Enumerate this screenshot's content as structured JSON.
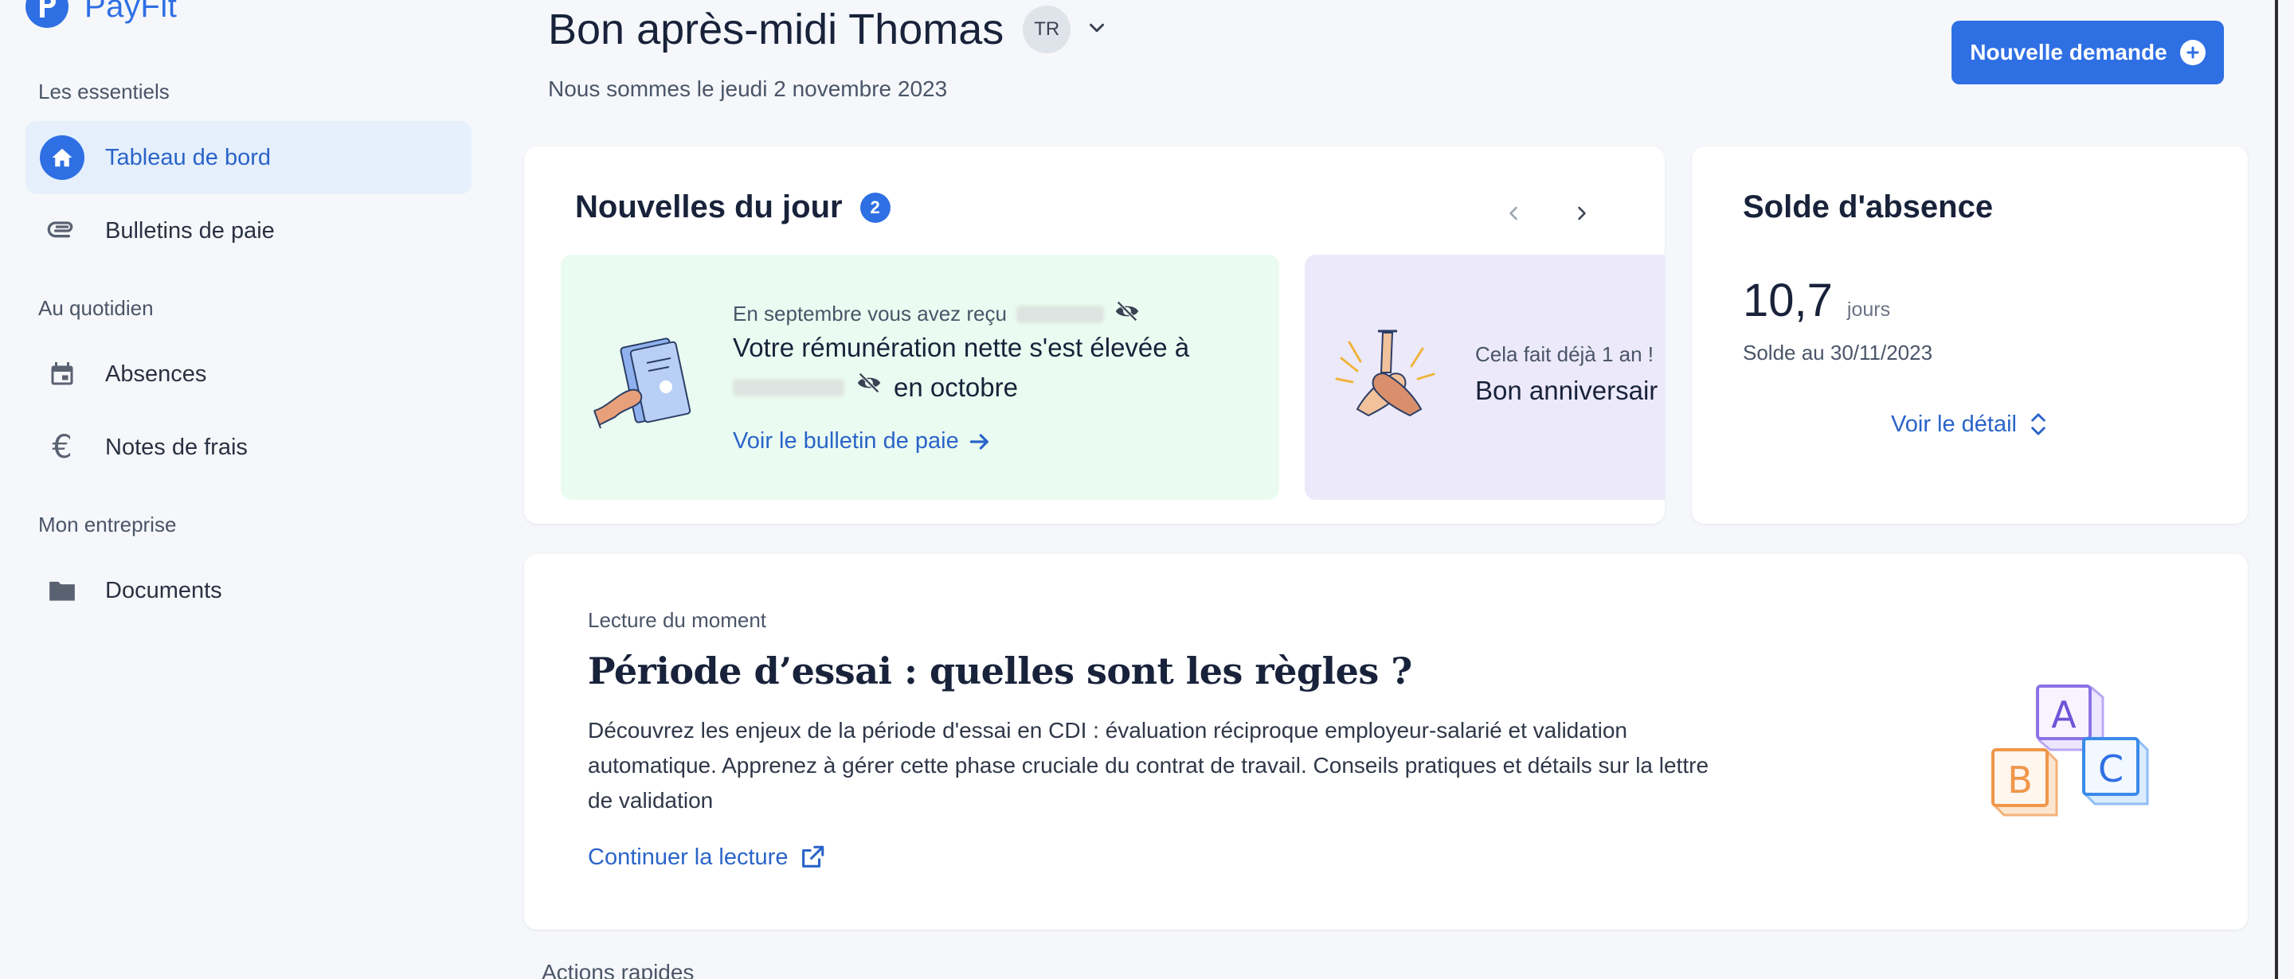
{
  "brand": {
    "name": "PayFit",
    "accent": "#2f6fe4"
  },
  "sidebar": {
    "sections": [
      {
        "label": "Les essentiels",
        "items": [
          {
            "label": "Tableau de bord",
            "icon": "home-icon",
            "active": true
          },
          {
            "label": "Bulletins de paie",
            "icon": "paperclip-icon",
            "active": false
          }
        ]
      },
      {
        "label": "Au quotidien",
        "items": [
          {
            "label": "Absences",
            "icon": "calendar-icon",
            "active": false
          },
          {
            "label": "Notes de frais",
            "icon": "euro-icon",
            "active": false
          }
        ]
      },
      {
        "label": "Mon entreprise",
        "items": [
          {
            "label": "Documents",
            "icon": "folder-icon",
            "active": false
          }
        ]
      }
    ]
  },
  "header": {
    "greeting": "Bon après-midi Thomas",
    "avatar_initials": "TR",
    "date": "Nous sommes le jeudi 2 novembre 2023",
    "new_request_label": "Nouvelle demande"
  },
  "news": {
    "title": "Nouvelles du jour",
    "count": "2",
    "items": [
      {
        "subtitle": "En septembre vous avez reçu",
        "main_line1": "Votre rémunération nette s'est élevée à",
        "main_line2_suffix": "en octobre",
        "link": "Voir le bulletin de paie"
      },
      {
        "subtitle": "Cela fait déjà 1 an !",
        "main": "Bon anniversair"
      }
    ]
  },
  "absence": {
    "title": "Solde d'absence",
    "value": "10,7",
    "unit": "jours",
    "balance_date": "Solde au 30/11/2023",
    "link": "Voir le détail"
  },
  "reading": {
    "kicker": "Lecture du moment",
    "title": "Période d’essai : quelles sont les règles ?",
    "body": "Découvrez les enjeux de la période d'essai en CDI : évaluation réciproque employeur-salarié et validation automatique. Apprenez à gérer cette phase cruciale du contrat de travail. Conseils pratiques et détails sur la lettre de validation",
    "link": "Continuer la lecture",
    "blocks": [
      "A",
      "B",
      "C"
    ]
  },
  "quick_actions": {
    "label": "Actions rapides"
  }
}
